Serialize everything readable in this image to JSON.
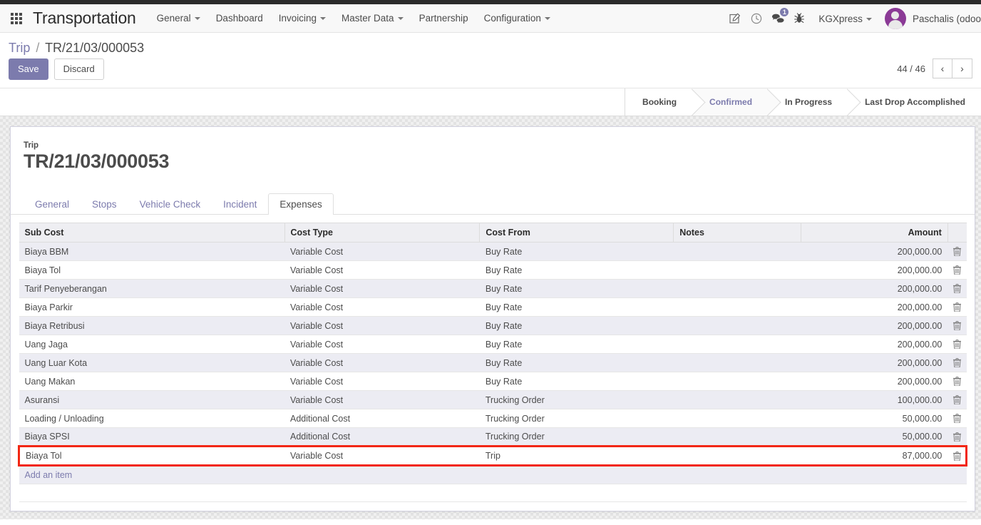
{
  "navbar": {
    "apps_icon": "apps-grid-icon",
    "brand": "Transportation",
    "menus": [
      {
        "label": "General",
        "has_caret": true
      },
      {
        "label": "Dashboard",
        "has_caret": false
      },
      {
        "label": "Invoicing",
        "has_caret": true
      },
      {
        "label": "Master Data",
        "has_caret": true
      },
      {
        "label": "Partnership",
        "has_caret": false
      },
      {
        "label": "Configuration",
        "has_caret": true
      }
    ],
    "icons": [
      {
        "name": "edit-icon"
      },
      {
        "name": "clock-icon"
      },
      {
        "name": "messages-icon",
        "badge": "1"
      },
      {
        "name": "bug-icon"
      }
    ],
    "company": "KGXpress",
    "user_name": "Paschalis (odoo"
  },
  "control_panel": {
    "breadcrumb_root": "Trip",
    "breadcrumb_separator": "/",
    "breadcrumb_current": "TR/21/03/000053",
    "save_label": "Save",
    "discard_label": "Discard",
    "pager_value": "44 / 46",
    "pager_prev": "‹",
    "pager_next": "›"
  },
  "statusbar": {
    "items": [
      {
        "label": "Booking",
        "active": false
      },
      {
        "label": "Confirmed",
        "active": true
      },
      {
        "label": "In Progress",
        "active": false
      },
      {
        "label": "Last Drop Accomplished",
        "active": false
      }
    ]
  },
  "sheet": {
    "field_label": "Trip",
    "title": "TR/21/03/000053"
  },
  "notebook": {
    "tabs": [
      {
        "label": "General",
        "active": false
      },
      {
        "label": "Stops",
        "active": false
      },
      {
        "label": "Vehicle Check",
        "active": false
      },
      {
        "label": "Incident",
        "active": false
      },
      {
        "label": "Expenses",
        "active": true
      }
    ]
  },
  "expenses_table": {
    "columns": [
      "Sub Cost",
      "Cost Type",
      "Cost From",
      "Notes",
      "",
      "Amount"
    ],
    "rows": [
      {
        "sub_cost": "Biaya BBM",
        "cost_type": "Variable Cost",
        "cost_from": "Buy Rate",
        "notes": "",
        "amount": "200,000.00",
        "highlighted": false
      },
      {
        "sub_cost": "Biaya Tol",
        "cost_type": "Variable Cost",
        "cost_from": "Buy Rate",
        "notes": "",
        "amount": "200,000.00",
        "highlighted": false
      },
      {
        "sub_cost": "Tarif Penyeberangan",
        "cost_type": "Variable Cost",
        "cost_from": "Buy Rate",
        "notes": "",
        "amount": "200,000.00",
        "highlighted": false
      },
      {
        "sub_cost": "Biaya Parkir",
        "cost_type": "Variable Cost",
        "cost_from": "Buy Rate",
        "notes": "",
        "amount": "200,000.00",
        "highlighted": false
      },
      {
        "sub_cost": "Biaya Retribusi",
        "cost_type": "Variable Cost",
        "cost_from": "Buy Rate",
        "notes": "",
        "amount": "200,000.00",
        "highlighted": false
      },
      {
        "sub_cost": "Uang Jaga",
        "cost_type": "Variable Cost",
        "cost_from": "Buy Rate",
        "notes": "",
        "amount": "200,000.00",
        "highlighted": false
      },
      {
        "sub_cost": "Uang Luar Kota",
        "cost_type": "Variable Cost",
        "cost_from": "Buy Rate",
        "notes": "",
        "amount": "200,000.00",
        "highlighted": false
      },
      {
        "sub_cost": "Uang Makan",
        "cost_type": "Variable Cost",
        "cost_from": "Buy Rate",
        "notes": "",
        "amount": "200,000.00",
        "highlighted": false
      },
      {
        "sub_cost": "Asuransi",
        "cost_type": "Variable Cost",
        "cost_from": "Trucking Order",
        "notes": "",
        "amount": "100,000.00",
        "highlighted": false
      },
      {
        "sub_cost": "Loading / Unloading",
        "cost_type": "Additional Cost",
        "cost_from": "Trucking Order",
        "notes": "",
        "amount": "50,000.00",
        "highlighted": false
      },
      {
        "sub_cost": "Biaya SPSI",
        "cost_type": "Additional Cost",
        "cost_from": "Trucking Order",
        "notes": "",
        "amount": "50,000.00",
        "highlighted": false
      },
      {
        "sub_cost": "Biaya Tol",
        "cost_type": "Variable Cost",
        "cost_from": "Trip",
        "notes": "",
        "amount": "87,000.00",
        "highlighted": true
      }
    ],
    "add_item_label": "Add an item",
    "delete_icon": "trash-icon"
  },
  "colors": {
    "accent": "#7c7bad",
    "highlight": "#f22613",
    "avatar": "#8b3a96",
    "row_odd": "#ececf3",
    "header_bg": "#eeeef2"
  }
}
